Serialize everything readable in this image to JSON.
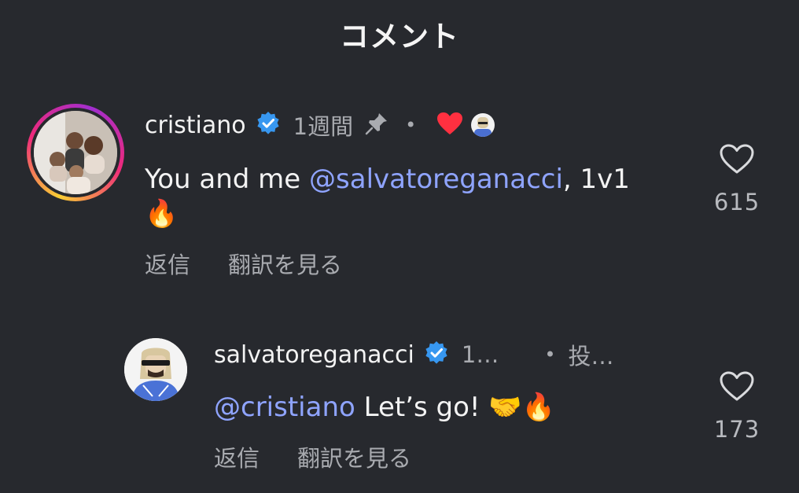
{
  "header": {
    "title": "コメント"
  },
  "comments": [
    {
      "username": "cristiano",
      "time": "1週間",
      "text_before": "You and me ",
      "mention": "@salvatoreganacci",
      "text_after": ", 1v1",
      "emoji_line": "🔥",
      "reply_label": "返信",
      "translate_label": "翻訳を見る",
      "likes": "615",
      "liked_by_author_icon": "heart-icon"
    },
    {
      "username": "salvatoreganacci",
      "time": "1…",
      "posted_label": "投…",
      "mention": "@cristiano",
      "text_after": " Let’s go! 🤝🔥",
      "reply_label": "返信",
      "translate_label": "翻訳を見る",
      "likes": "173"
    }
  ],
  "colors": {
    "background": "#27292e",
    "mention": "#8fa4ff",
    "verified": "#3797f0",
    "heart": "#ff3040",
    "muted": "#a9abb0"
  }
}
